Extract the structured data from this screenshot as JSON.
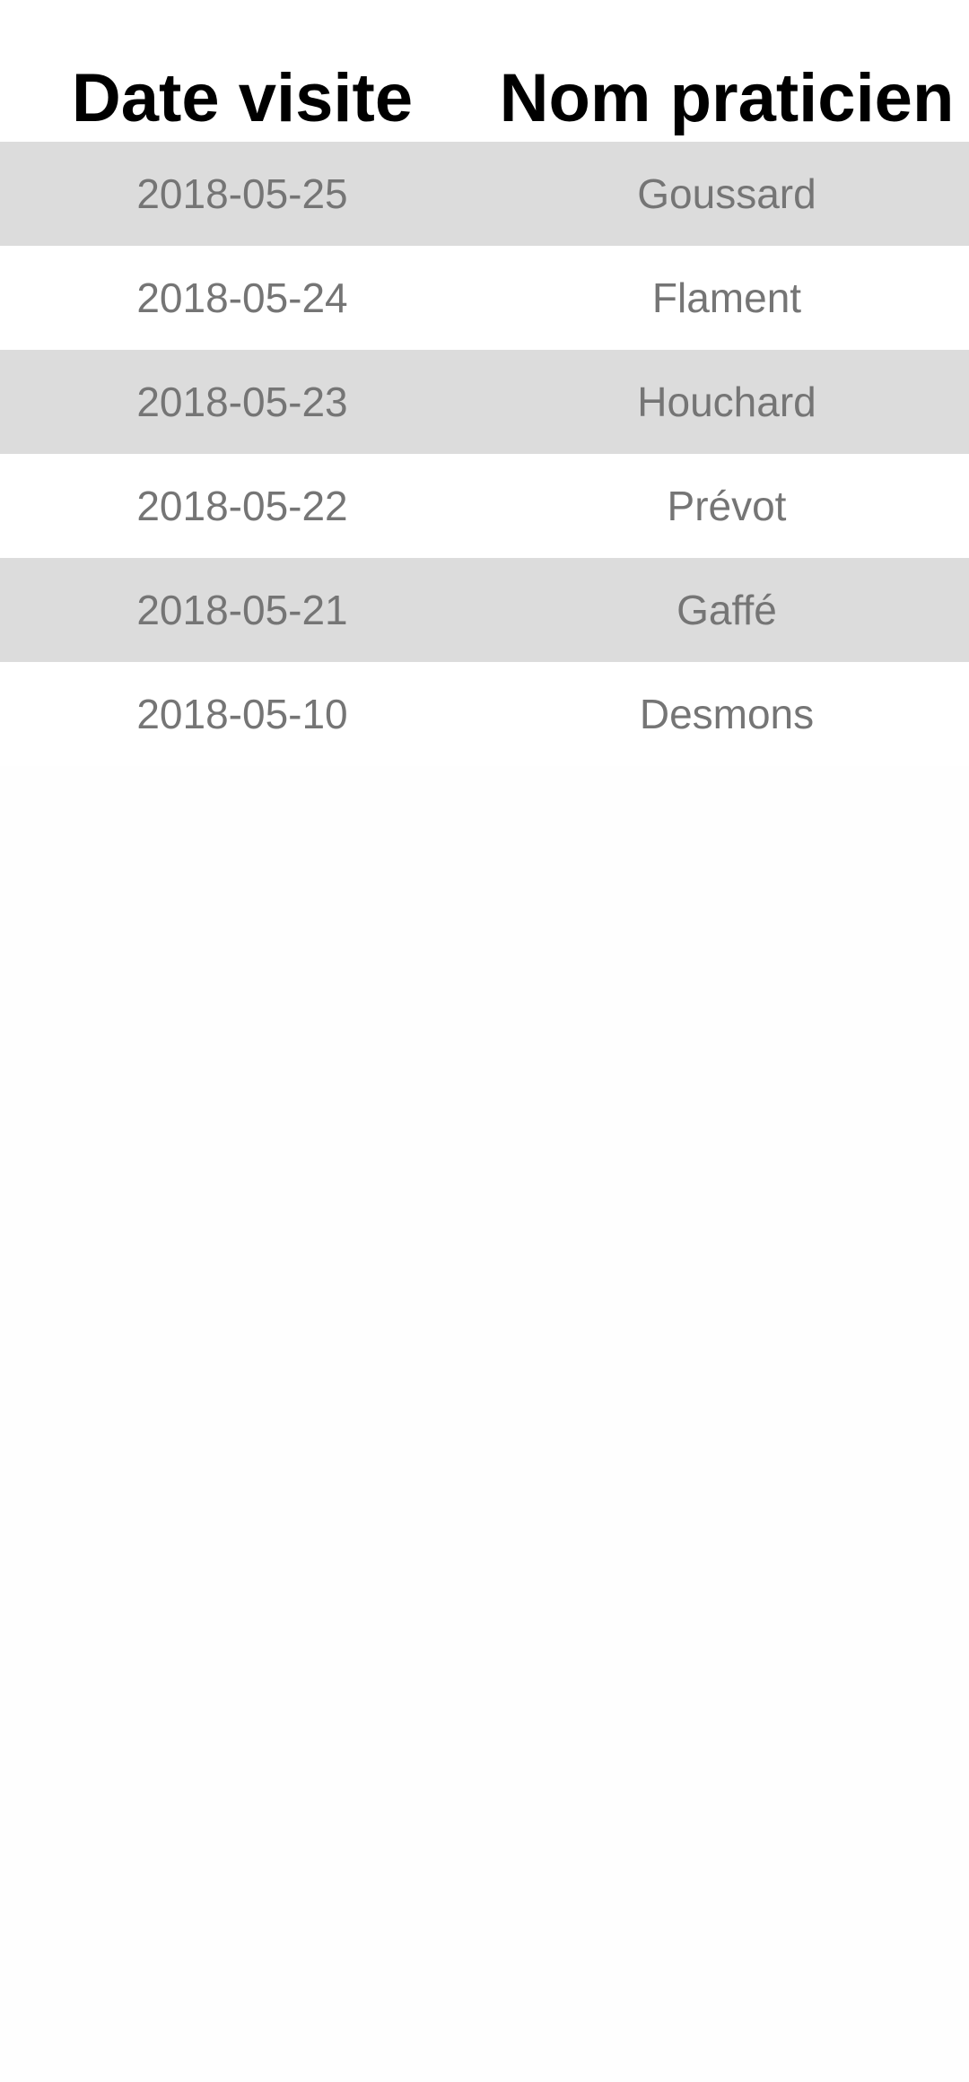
{
  "table": {
    "headers": {
      "date": "Date visite",
      "name": "Nom praticien"
    },
    "rows": [
      {
        "date": "2018-05-25",
        "name": "Goussard"
      },
      {
        "date": "2018-05-24",
        "name": "Flament"
      },
      {
        "date": "2018-05-23",
        "name": "Houchard"
      },
      {
        "date": "2018-05-22",
        "name": "Prévot"
      },
      {
        "date": "2018-05-21",
        "name": "Gaffé"
      },
      {
        "date": "2018-05-10",
        "name": "Desmons"
      }
    ]
  },
  "colors": {
    "shaded_row": "#dcdcdc",
    "plain_row": "#ffffff",
    "cell_text": "#757575",
    "header_text": "#000000",
    "background": "#fefefe"
  }
}
